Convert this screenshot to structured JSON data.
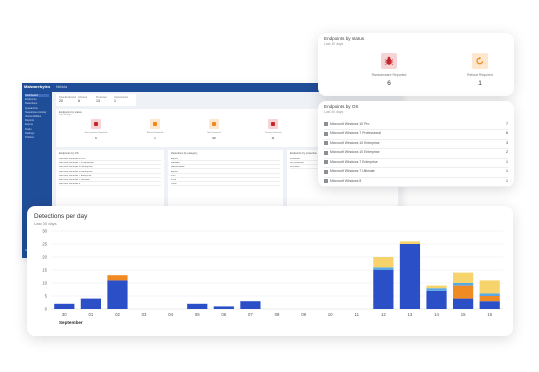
{
  "dashboard": {
    "brand": "Malwarebytes",
    "title": "Nebula",
    "sidebar": [
      {
        "label": "Dashboard",
        "active": true
      },
      {
        "label": "Endpoints",
        "active": false
      },
      {
        "label": "Detections",
        "active": false
      },
      {
        "label": "Quarantine",
        "active": false
      },
      {
        "label": "Suspicious Activity",
        "active": false
      },
      {
        "label": "Vulnerabilities",
        "active": false
      },
      {
        "label": "Reports",
        "active": false
      },
      {
        "label": "Events",
        "active": false
      },
      {
        "label": "Tasks",
        "active": false
      },
      {
        "label": "Settings",
        "active": false
      },
      {
        "label": "Policies",
        "active": false
      }
    ],
    "help_label": "Need Help?",
    "stats": [
      {
        "label": "Total Endpoints",
        "value": "20"
      },
      {
        "label": "Infected",
        "value": "6"
      },
      {
        "label": "Protected",
        "value": "13"
      },
      {
        "label": "Unprotected",
        "value": "1"
      }
    ],
    "status_title": "Endpoints by status",
    "status_sub": "Last 30 days",
    "status_items": [
      {
        "label": "Ransomware Reported",
        "value": "6",
        "color": "#f6d4d6",
        "ico": "#c4262e"
      },
      {
        "label": "Reboot Required",
        "value": "1",
        "color": "#fde7cf",
        "ico": "#ef8a18"
      },
      {
        "label": "Not Protected",
        "value": "90",
        "color": "#fde7cf",
        "ico": "#ef8a18"
      },
      {
        "label": "Threats Detected",
        "value": "11",
        "color": "#f6d4d6",
        "ico": "#c4262e"
      },
      {
        "label": "Needs Attention",
        "value": "1",
        "color": "#fde7cf",
        "ico": "#ef8a18"
      }
    ],
    "mini_panels": [
      {
        "title": "Endpoints by OS",
        "rows": [
          "Microsoft Windows 10 Pro",
          "Microsoft Windows 7 Professional",
          "Microsoft Windows 10 Enterprise",
          "Microsoft Windows 10 Enterprise",
          "Microsoft Windows 7 Enterprise",
          "Microsoft Windows 7 Ultimate",
          "Microsoft Windows 8"
        ]
      },
      {
        "title": "Detections by category",
        "rows": [
          "Exploit",
          "Malware",
          "Ransomware",
          "Exploit",
          "PUP",
          "PUM",
          "Other"
        ]
      },
      {
        "title": "Endpoints by protection",
        "rows": [
          "Protected",
          "Not protected",
          "Unknown"
        ]
      }
    ]
  },
  "status_card": {
    "title": "Endpoints by status",
    "subtitle": "Last 30 days",
    "items": [
      {
        "label": "Ransomware Reported",
        "value": "6",
        "icon": "ransomware-bug-icon",
        "tile": "#f6d4d6",
        "color": "#c4262e"
      },
      {
        "label": "Reboot Required",
        "value": "1",
        "icon": "reboot-icon",
        "tile": "#fde7cf",
        "color": "#ef8a18"
      }
    ]
  },
  "os_card": {
    "title": "Endpoints by OS",
    "subtitle": "Last 30 days",
    "rows": [
      {
        "name": "Microsoft Windows 10 Pro",
        "count": "7"
      },
      {
        "name": "Microsoft Windows 7 Professional",
        "count": "6"
      },
      {
        "name": "Microsoft Windows 10 Enterprise",
        "count": "3"
      },
      {
        "name": "Microsoft Windows 10 Enterprise",
        "count": "2"
      },
      {
        "name": "Microsoft Windows 7 Enterprise",
        "count": "1"
      },
      {
        "name": "Microsoft Windows 7 Ultimate",
        "count": "1"
      },
      {
        "name": "Microsoft Windows 8",
        "count": "1"
      }
    ]
  },
  "detections_card": {
    "title": "Detections per day",
    "subtitle": "Last 30 days"
  },
  "chart_data": {
    "type": "bar",
    "stacked": true,
    "title": "Detections per day",
    "subtitle": "Last 30 days",
    "xlabel": "September",
    "ylabel": "",
    "ylim": [
      0,
      30
    ],
    "yticks": [
      0,
      5,
      10,
      15,
      20,
      25,
      30
    ],
    "grid": true,
    "categories": [
      "30",
      "01",
      "02",
      "03",
      "04",
      "05",
      "06",
      "07",
      "08",
      "09",
      "10",
      "11",
      "12",
      "13",
      "14",
      "15",
      "16"
    ],
    "colors": [
      "#2b4fc7",
      "#f08a24",
      "#5aa9e6",
      "#f6d36b"
    ],
    "series": [
      {
        "values": [
          2,
          4,
          11,
          0,
          0,
          2,
          1,
          3,
          0,
          0,
          0,
          0,
          15,
          25,
          7,
          4,
          3
        ]
      },
      {
        "values": [
          0,
          0,
          2,
          0,
          0,
          0,
          0,
          0,
          0,
          0,
          0,
          0,
          0,
          0,
          0,
          5,
          2
        ]
      },
      {
        "values": [
          0,
          0,
          0,
          0,
          0,
          0,
          0,
          0,
          0,
          0,
          0,
          0,
          1,
          0,
          1,
          1,
          1
        ]
      },
      {
        "values": [
          0,
          0,
          0,
          0,
          0,
          0,
          0,
          0,
          0,
          0,
          0,
          0,
          4,
          1,
          1,
          4,
          5
        ]
      }
    ]
  }
}
